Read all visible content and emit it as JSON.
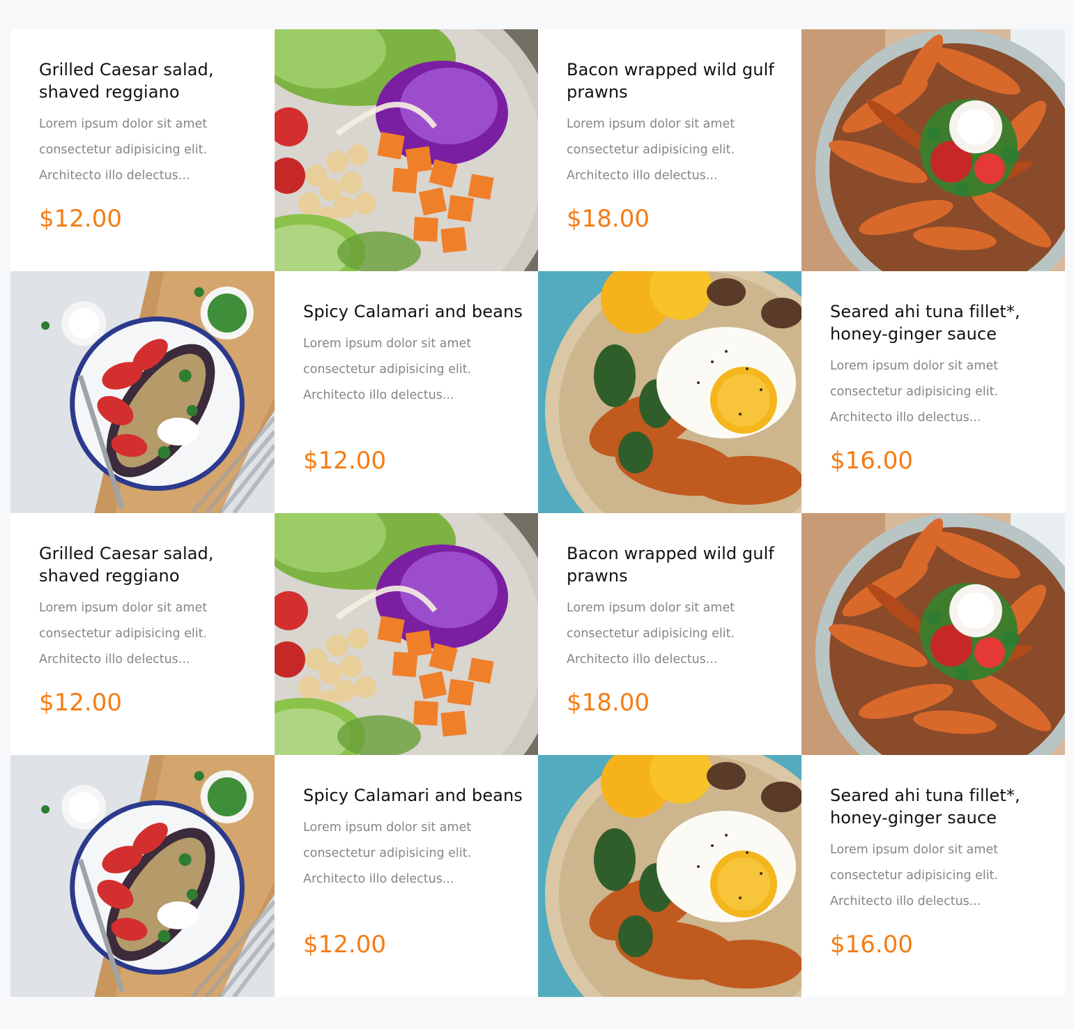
{
  "items": [
    {
      "type": "text",
      "name": "Grilled Caesar salad, shaved reggiano",
      "description": "Lorem ipsum dolor sit amet consectetur adipisicing elit. Architecto illo delectus...",
      "price": "$12.00"
    },
    {
      "type": "image",
      "photo": "bowl"
    },
    {
      "type": "text",
      "name": "Bacon wrapped wild gulf prawns",
      "description": "Lorem ipsum dolor sit amet consectetur adipisicing elit. Architecto illo delectus...",
      "price": "$18.00"
    },
    {
      "type": "image",
      "photo": "fries"
    },
    {
      "type": "image",
      "photo": "eggplant"
    },
    {
      "type": "text",
      "name": "Spicy Calamari and beans",
      "description": "Lorem ipsum dolor sit amet consectetur adipisicing elit. Architecto illo delectus...",
      "price": "$12.00"
    },
    {
      "type": "image",
      "photo": "egg"
    },
    {
      "type": "text",
      "name": "Seared ahi tuna fillet*, honey-ginger sauce",
      "description": "Lorem ipsum dolor sit amet consectetur adipisicing elit. Architecto illo delectus...",
      "price": "$16.00"
    },
    {
      "type": "text",
      "name": "Grilled Caesar salad, shaved reggiano",
      "description": "Lorem ipsum dolor sit amet consectetur adipisicing elit. Architecto illo delectus...",
      "price": "$12.00"
    },
    {
      "type": "image",
      "photo": "bowl"
    },
    {
      "type": "text",
      "name": "Bacon wrapped wild gulf prawns",
      "description": "Lorem ipsum dolor sit amet consectetur adipisicing elit. Architecto illo delectus...",
      "price": "$18.00"
    },
    {
      "type": "image",
      "photo": "fries"
    },
    {
      "type": "image",
      "photo": "eggplant"
    },
    {
      "type": "text",
      "name": "Spicy Calamari and beans",
      "description": "Lorem ipsum dolor sit amet consectetur adipisicing elit. Architecto illo delectus...",
      "price": "$12.00"
    },
    {
      "type": "image",
      "photo": "egg"
    },
    {
      "type": "text",
      "name": "Seared ahi tuna fillet*, honey-ginger sauce",
      "description": "Lorem ipsum dolor sit amet consectetur adipisicing elit. Architecto illo delectus...",
      "price": "$16.00"
    }
  ],
  "colors": {
    "price": "#f47c14",
    "title": "#111111",
    "description": "#858585",
    "page_background": "#f7f8fa",
    "card_background": "#ffffff"
  }
}
